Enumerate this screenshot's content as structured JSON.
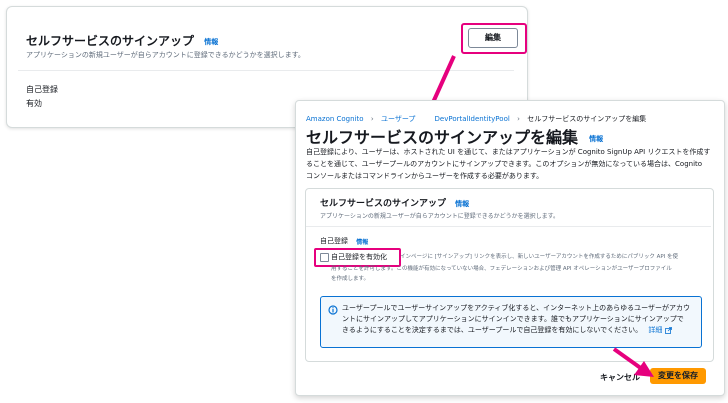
{
  "back": {
    "title": "セルフサービスのサインアップ",
    "info": "情報",
    "desc": "アプリケーションの新規ユーザーが自らアカウントに登録できるかどうかを選択します。",
    "self_reg_label": "自己登録",
    "self_reg_value": "有効",
    "edit_label": "編集"
  },
  "breadcrumb": {
    "items": [
      "Amazon Cognito",
      "ユーザープ",
      "DevPortalIdentityPool",
      "セルフサービスのサインアップを編集"
    ]
  },
  "page": {
    "title": "セルフサービスのサインアップを編集",
    "info": "情報",
    "desc_lines": [
      "自己登録により、ユーザーは、ホストされた UI を通じて、またはアプリケーションが Cognito SignUp API リクエストを作成す",
      "ることを通じて、ユーザープールのアカウントにサインアップできます。このオプションが無効になっている場合は、Cognito",
      "コンソールまたはコマンドラインからユーザーを作成する必要があります。"
    ]
  },
  "section": {
    "title": "セルフサービスのサインアップ",
    "info": "情報",
    "desc": "アプリケーションの新規ユーザーが自らアカウントに登録できるかどうかを選択します。",
    "self_reg_label": "自己登録",
    "self_reg_info": "情報",
    "checkbox_label": "自己登録を有効化",
    "help_lines": [
      "インページに [サインアップ] リンクを表示し、新しいユーザーアカウントを作成するためにパブリック API を使",
      "用することを許可します。この機能が有効になっていない場合、フェデレーションおよび管理 API オペレーションがユーザープロファイル",
      "を作成します。"
    ]
  },
  "alert": {
    "lines": [
      "ユーザープールでユーザーサインアップをアクティブ化すると、インターネット上のあらゆるユーザーがアカウ",
      "ントにサインアップしてアプリケーションにサインインできます。誰でもアプリケーションにサインアップで",
      "きるようにすることを決定するまでは、ユーザープールで自己登録を有効にしないでください。"
    ],
    "link": "詳細"
  },
  "footer": {
    "cancel": "キャンセル",
    "save": "変更を保存"
  },
  "colors": {
    "highlight": "#e6007e",
    "primary_button": "#ff9900",
    "link": "#0972d3"
  }
}
